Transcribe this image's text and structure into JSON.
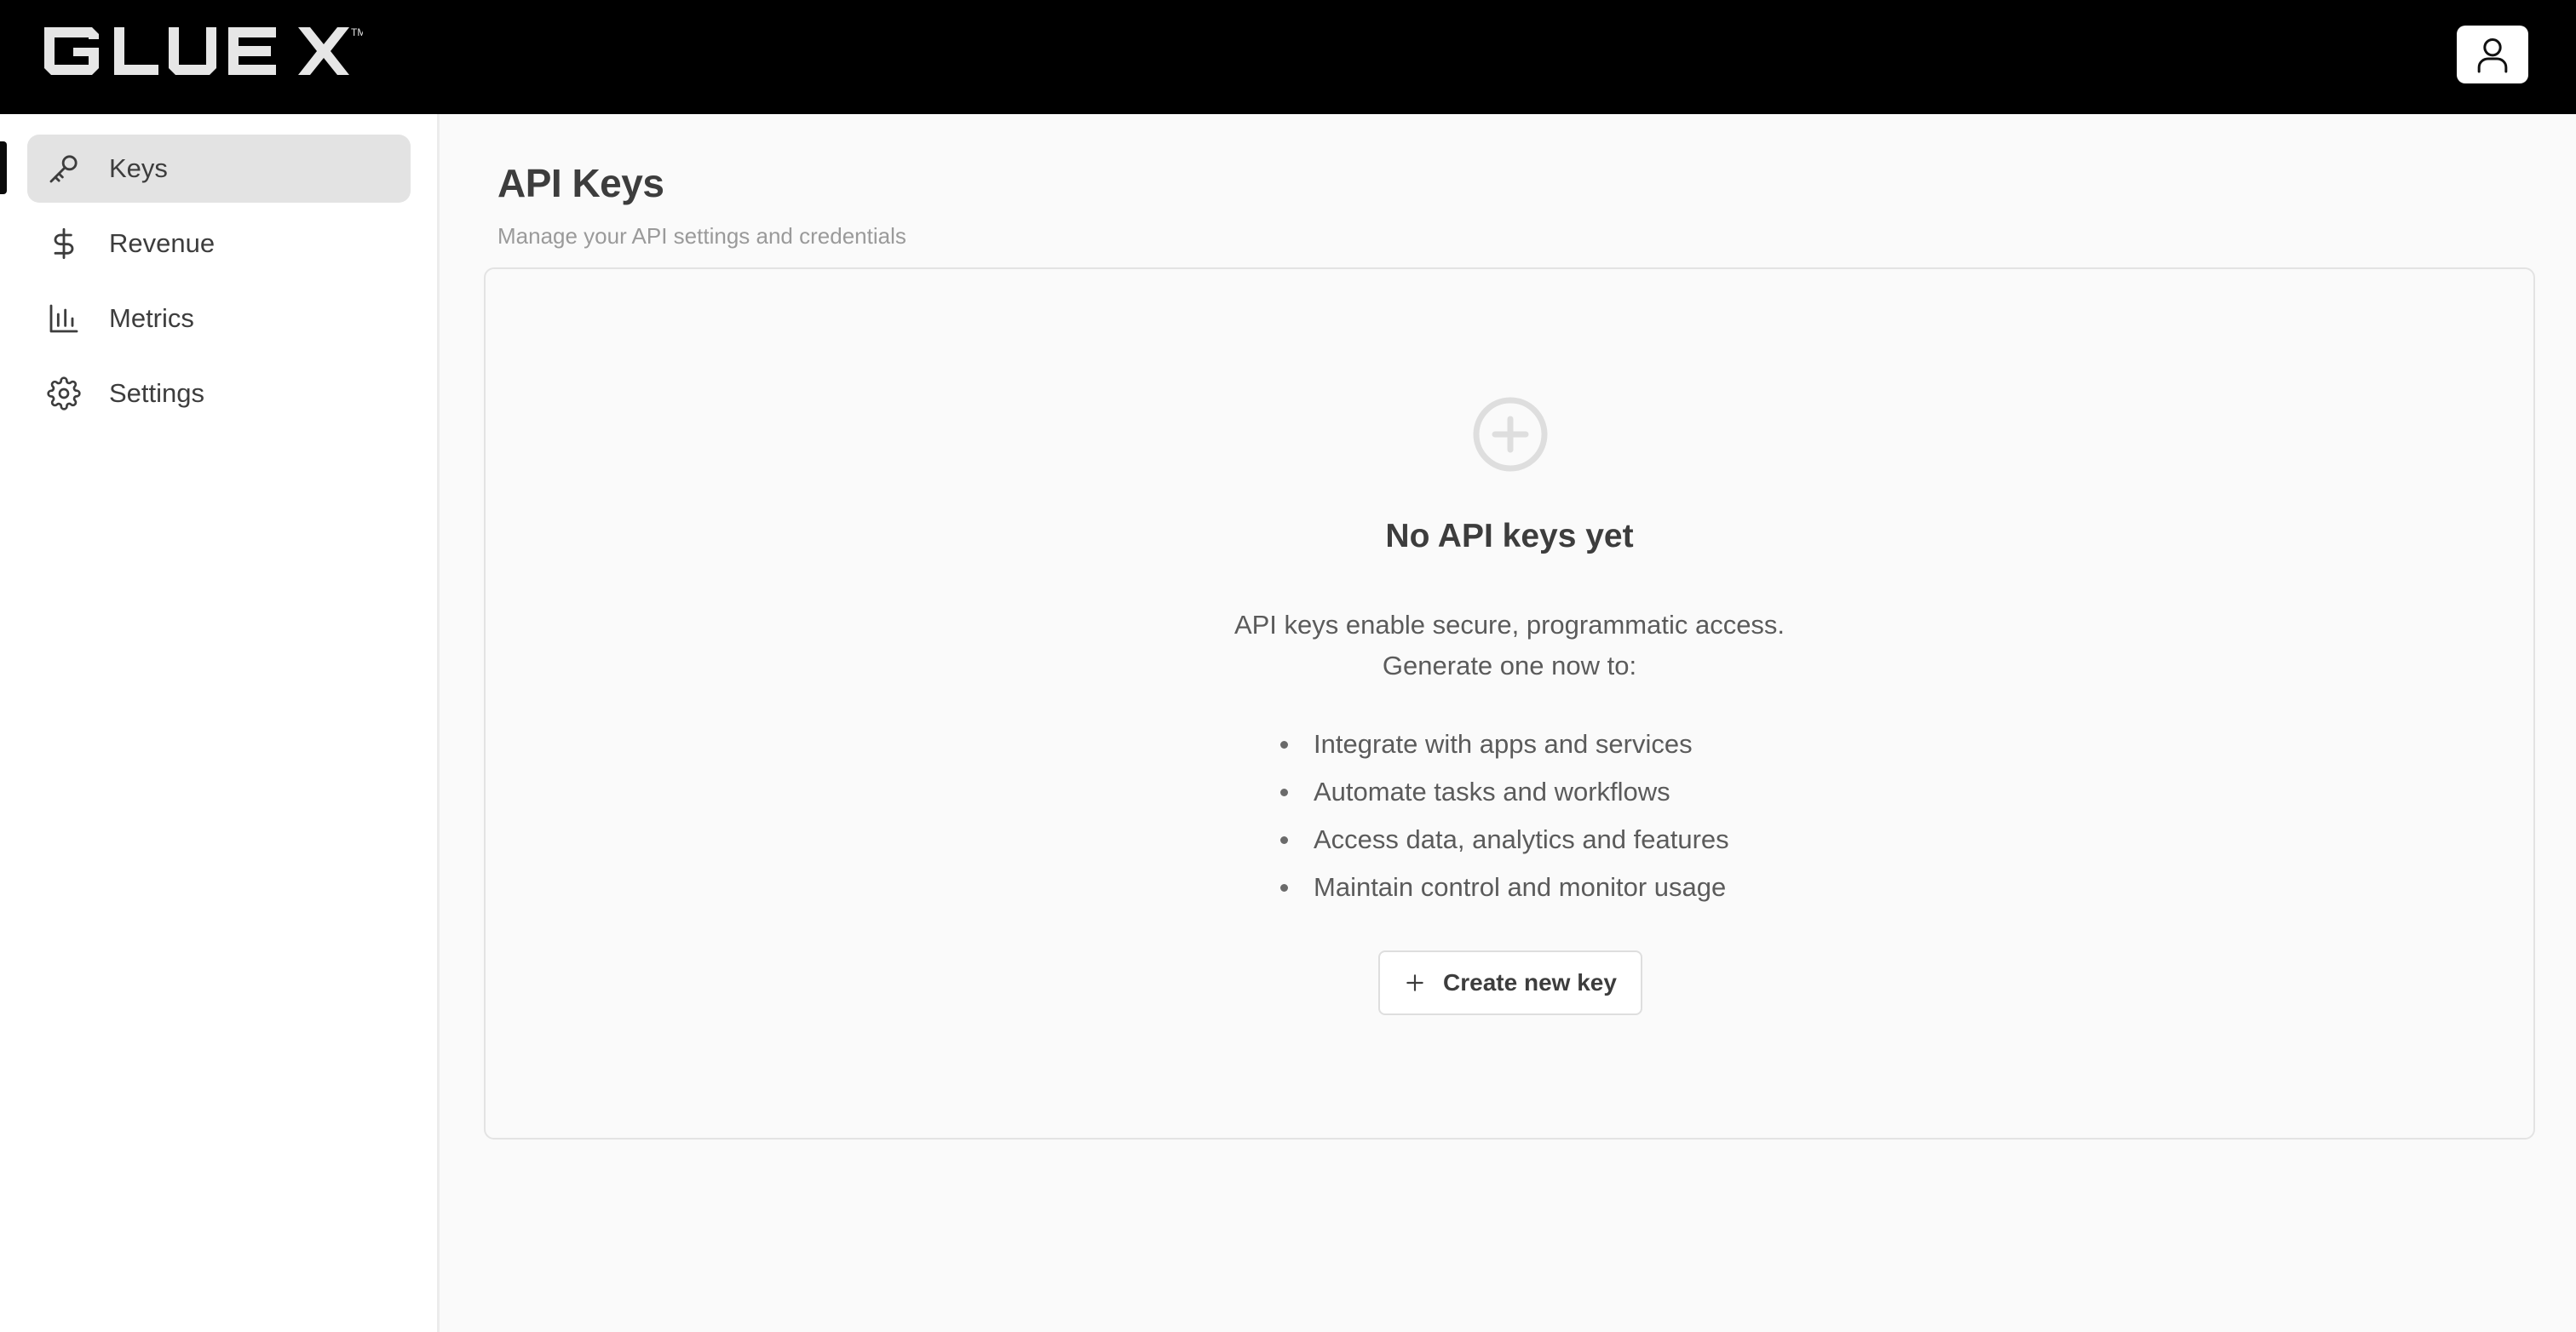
{
  "header": {
    "logo_text": "GLUE X",
    "logo_trademark": "TM",
    "avatar_icon": "user-icon"
  },
  "sidebar": {
    "items": [
      {
        "label": "Keys",
        "icon": "key-icon",
        "active": true
      },
      {
        "label": "Revenue",
        "icon": "dollar-icon",
        "active": false
      },
      {
        "label": "Metrics",
        "icon": "bar-chart-icon",
        "active": false
      },
      {
        "label": "Settings",
        "icon": "gear-icon",
        "active": false
      }
    ]
  },
  "main": {
    "title": "API Keys",
    "subtitle": "Manage your API settings and credentials",
    "empty_state": {
      "icon": "plus-circle-icon",
      "title": "No API keys yet",
      "description_line1": "API keys enable secure, programmatic access.",
      "description_line2": "Generate one now to:",
      "benefits": [
        "Integrate with apps and services",
        "Automate tasks and workflows",
        "Access data, analytics and features",
        "Maintain control and monitor usage"
      ],
      "create_button_label": "Create new key",
      "create_button_icon": "plus-icon"
    }
  },
  "colors": {
    "header_bg": "#000000",
    "active_nav_bg": "#e3e3e3",
    "page_bg": "#fafafa",
    "text": "#3d3d3d",
    "muted_text": "#9a9a9a"
  }
}
